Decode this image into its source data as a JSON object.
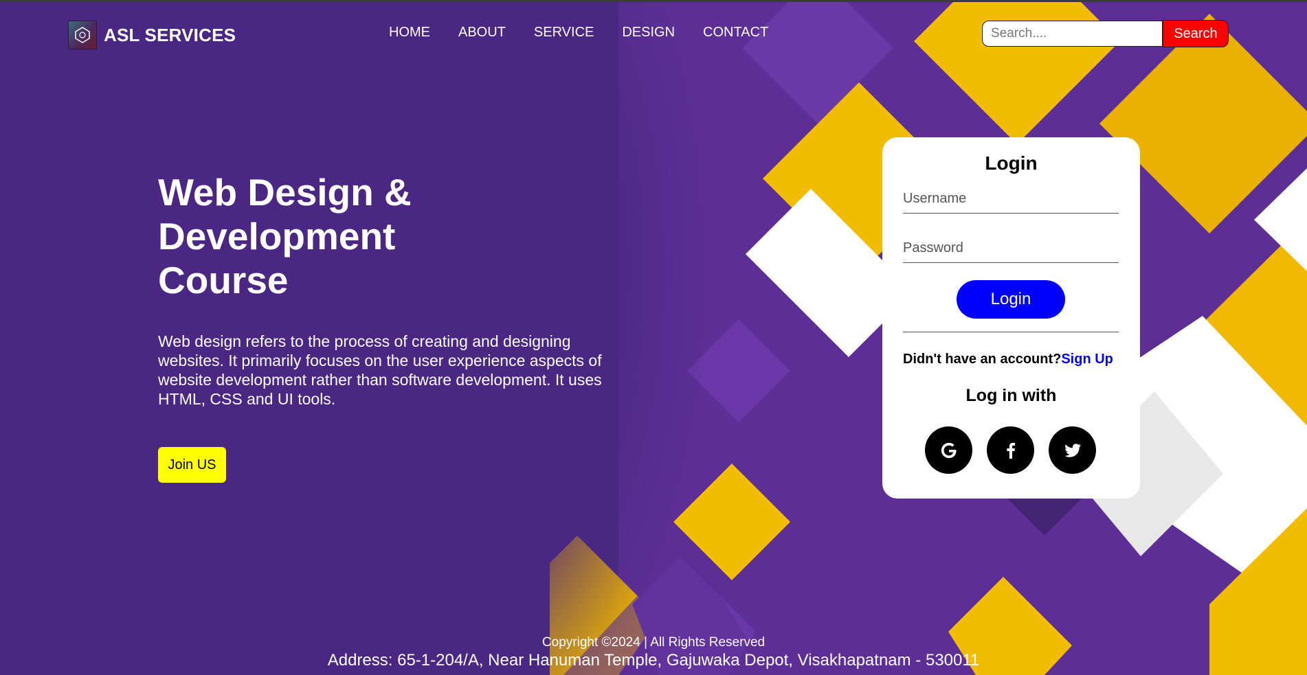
{
  "colors": {
    "background_purple": "#4a2783",
    "accent_yellow": "#f2bd00",
    "search_button_red": "#ff0000",
    "login_button_blue": "#0000ff",
    "join_button_yellow": "#ffff00",
    "signup_link_blue": "#0000ff"
  },
  "brand": {
    "logo_icon": "asl-services-logo-icon",
    "name": "ASL SERVICES"
  },
  "nav": {
    "items": [
      {
        "label": "HOME"
      },
      {
        "label": "ABOUT"
      },
      {
        "label": "SERVICE"
      },
      {
        "label": "DESIGN"
      },
      {
        "label": "CONTACT"
      }
    ]
  },
  "search": {
    "placeholder": "Search....",
    "value": "",
    "button_label": "Search"
  },
  "hero": {
    "title": "Web Design & Development Course",
    "description": "Web design refers to the process of creating and designing websites. It primarily focuses on the user experience aspects of website development rather than software development. It uses HTML, CSS and UI tools.",
    "join_label": "Join US"
  },
  "login": {
    "title": "Login",
    "username_placeholder": "Username",
    "password_placeholder": "Password",
    "button_label": "Login",
    "no_account_text": "Didn't have an account?",
    "signup_label": "Sign Up",
    "login_with_label": "Log in with",
    "social_icons": [
      "google-icon",
      "facebook-icon",
      "twitter-icon"
    ]
  },
  "footer": {
    "copyright": "Copyright ©2024 | All Rights Reserved",
    "address": "Address: 65-1-204/A, Near Hanuman Temple, Gajuwaka Depot, Visakhapatnam - 530011"
  }
}
